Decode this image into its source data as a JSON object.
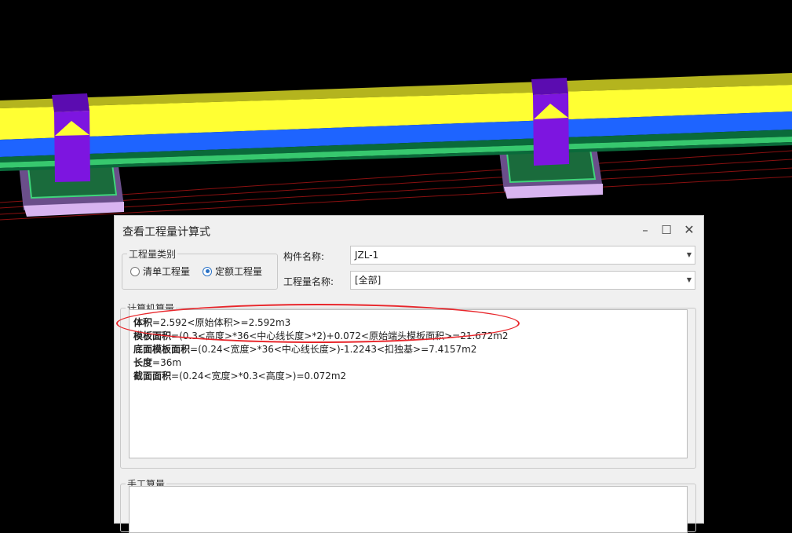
{
  "dialog": {
    "title": "查看工程量计算式",
    "minimize_glyph": "–",
    "maximize_glyph": "☐",
    "close_glyph": "✕"
  },
  "quantity_type": {
    "legend": "工程量类别",
    "options": [
      {
        "label": "清单工程量",
        "selected": false
      },
      {
        "label": "定额工程量",
        "selected": true
      }
    ]
  },
  "component": {
    "label": "构件名称:",
    "value": "JZL-1"
  },
  "quantity_name": {
    "label": "工程量名称:",
    "value": "[全部]"
  },
  "computer_calc": {
    "legend": "计算机算量",
    "lines": [
      {
        "name": "体积",
        "formula": "=2.592<原始体积>=2.592m3"
      },
      {
        "name": "模板面积",
        "formula": "=(0.3<高度>*36<中心线长度>*2)+0.072<原始端头模板面积>=21.672m2"
      },
      {
        "name": "底面模板面积",
        "formula": "=(0.24<宽度>*36<中心线长度>)-1.2243<扣独基>=7.4157m2"
      },
      {
        "name": "长度",
        "formula": "=36m"
      },
      {
        "name": "截面面积",
        "formula": "=(0.24<宽度>*0.3<高度>)=0.072m2"
      }
    ]
  },
  "manual_calc": {
    "legend": "手工算量"
  },
  "colors": {
    "beam_top": "#ffff33",
    "beam_side": "#1e64ff",
    "column": "#7d15e0",
    "footing": "#1a6b3c",
    "annotation": "#e8262b"
  }
}
